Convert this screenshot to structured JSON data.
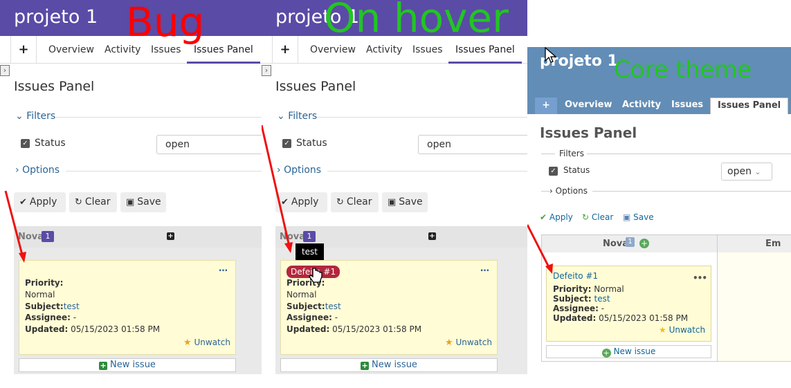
{
  "panels": [
    {
      "id": "bug",
      "annotation": "Bug",
      "project_title": "projeto 1",
      "tabs": [
        "Overview",
        "Activity",
        "Issues",
        "Issues Panel"
      ],
      "page_title": "Issues Panel",
      "filters_label": "Filters",
      "status_label": "Status",
      "status_value": "open",
      "options_label": "Options",
      "apply": "Apply",
      "clear": "Clear",
      "save": "Save",
      "column_name": "Nova",
      "column_count": "1",
      "card": {
        "priority_label": "Priority:",
        "priority_value": "Normal",
        "subject_label": "Subject:",
        "subject_value": "test",
        "assignee_label": "Assignee:",
        "assignee_value": "-",
        "updated_label": "Updated:",
        "updated_value": "05/15/2023 01:58 PM",
        "watch": "Unwatch",
        "menu": "…"
      },
      "new_issue": "New issue"
    },
    {
      "id": "hover",
      "annotation": "On hover",
      "project_title": "projeto 1",
      "tabs": [
        "Overview",
        "Activity",
        "Issues",
        "Issues Panel"
      ],
      "page_title": "Issues Panel",
      "filters_label": "Filters",
      "status_label": "Status",
      "status_value": "open",
      "options_label": "Options",
      "apply": "Apply",
      "clear": "Clear",
      "save": "Save",
      "column_name": "Nova",
      "column_count": "1",
      "tooltip": "test",
      "card": {
        "title": "Defeito #1",
        "priority_label": "Priority:",
        "priority_value": "Normal",
        "subject_label": "Subject:",
        "subject_value": "test",
        "assignee_label": "Assignee:",
        "assignee_value": "-",
        "updated_label": "Updated:",
        "updated_value": "05/15/2023 01:58 PM",
        "watch": "Unwatch",
        "menu": "…"
      },
      "new_issue": "New issue"
    },
    {
      "id": "core",
      "annotation": "Core theme",
      "project_title": "projeto 1",
      "tabs": [
        "+",
        "Overview",
        "Activity",
        "Issues",
        "Issues Panel"
      ],
      "page_title": "Issues Panel",
      "filters_label": "Filters",
      "status_label": "Status",
      "status_value": "open",
      "options_label": "Options",
      "apply": "Apply",
      "clear": "Clear",
      "save": "Save",
      "column_name": "Nova",
      "column_count": "1",
      "column2_name": "Em",
      "card": {
        "title": "Defeito #1",
        "priority_label": "Priority:",
        "priority_value": "Normal",
        "subject_label": "Subject:",
        "subject_value": "test",
        "assignee_label": "Assignee:",
        "assignee_value": "-",
        "updated_label": "Updated:",
        "updated_value": "05/15/2023 01:58 PM",
        "watch": "Unwatch",
        "menu": "•••"
      },
      "new_issue": "New issue"
    }
  ],
  "colors": {
    "purple_header": "#5a4ba6",
    "core_header": "#628db6",
    "annotation_red": "#ff0000",
    "annotation_green": "#22c522",
    "card_bg": "#fffcd6",
    "defect_badge": "#b3273c"
  }
}
